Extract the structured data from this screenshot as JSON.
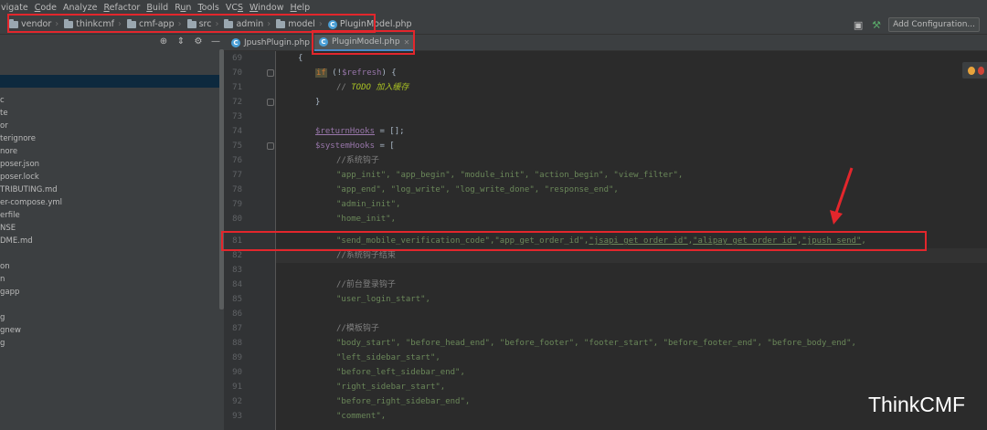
{
  "menu": [
    {
      "label": "Navigate",
      "display": "vigate",
      "mnemonic_index": -1
    },
    {
      "label": "Code",
      "display": "Code",
      "mnemonic_index": 0
    },
    {
      "label": "Analyze",
      "display": "Analyze",
      "mnemonic_index": -1
    },
    {
      "label": "Refactor",
      "display": "Refactor",
      "mnemonic_index": 0
    },
    {
      "label": "Build",
      "display": "Build",
      "mnemonic_index": 0
    },
    {
      "label": "Run",
      "display": "Run",
      "mnemonic_index": 1
    },
    {
      "label": "Tools",
      "display": "Tools",
      "mnemonic_index": 0
    },
    {
      "label": "VCS",
      "display": "VCS",
      "mnemonic_index": 2
    },
    {
      "label": "Window",
      "display": "Window",
      "mnemonic_index": 0
    },
    {
      "label": "Help",
      "display": "Help",
      "mnemonic_index": 0
    }
  ],
  "breadcrumb": [
    "vendor",
    "thinkcmf",
    "cmf-app",
    "src",
    "admin",
    "model"
  ],
  "breadcrumb_file": "PluginModel.php",
  "toolbar": {
    "add_config_label": "Add Configuration..."
  },
  "tabs": [
    {
      "label": "JpushPlugin.php",
      "active": false
    },
    {
      "label": "PluginModel.php",
      "active": true
    }
  ],
  "tree": [
    "c",
    "te",
    "or",
    "terignore",
    "nore",
    "poser.json",
    "poser.lock",
    "TRIBUTING.md",
    "er-compose.yml",
    "erfile",
    "NSE",
    "DME.md",
    "on",
    "n",
    "gapp",
    "g",
    "gnew",
    "g"
  ],
  "line_numbers": [
    69,
    70,
    71,
    72,
    73,
    74,
    75,
    76,
    77,
    78,
    79,
    80,
    81,
    82,
    83,
    84,
    85,
    86,
    87,
    88,
    89,
    90,
    91,
    92,
    93
  ],
  "code": {
    "l69": "{",
    "l70_kw": "if",
    "l70_open": " (!",
    "l70_var": "$refresh",
    "l70_close": ") {",
    "l71_comment": "// ",
    "l71_todo": "TODO",
    "l71_text": " 加入缓存",
    "l72": "}",
    "l74_var": "$returnHooks",
    "l74_rest": " = [];",
    "l75_var": "$systemHooks",
    "l75_rest": " = [",
    "l76": "//系统钩子",
    "l77": "\"app_init\", \"app_begin\", \"module_init\", \"action_begin\", \"view_filter\",",
    "l78": "\"app_end\", \"log_write\", \"log_write_done\", \"response_end\",",
    "l79": "\"admin_init\",",
    "l80": "\"home_init\",",
    "l81_a": "\"send_mobile_verification_code\",\"app_get_order_id\",",
    "l81_b": "\"jsapi_get_order_id\"",
    "l81_c": ",",
    "l81_d": "\"alipay_get_order_id\"",
    "l81_e": ",",
    "l81_f": "\"jpush_send\"",
    "l81_g": ",",
    "l82": "//系统钩子结束",
    "l84": "//前台登录钩子",
    "l85": "\"user_login_start\",",
    "l87": "//模板钩子",
    "l88": "\"body_start\", \"before_head_end\", \"before_footer\", \"footer_start\", \"before_footer_end\", \"before_body_end\",",
    "l89": "\"left_sidebar_start\",",
    "l90": "\"before_left_sidebar_end\",",
    "l91": "\"right_sidebar_start\",",
    "l92": "\"before_right_sidebar_end\",",
    "l93": "\"comment\","
  },
  "watermark": "ThinkCMF",
  "colors": {
    "annotation_red": "#e3262c",
    "string_green": "#6a8759",
    "keyword_orange": "#cc7832",
    "variable_purple": "#9876aa"
  }
}
